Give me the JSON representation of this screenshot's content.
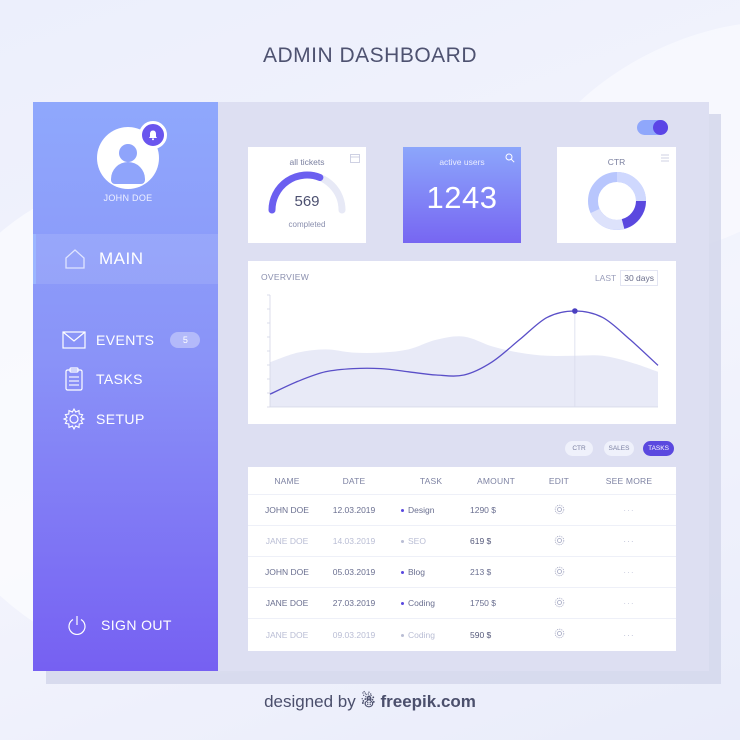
{
  "page_title": "ADMIN DASHBOARD",
  "sidebar": {
    "user_name": "JOHN DOE",
    "main_label": "MAIN",
    "items": [
      {
        "label": "EVENTS",
        "badge": "5",
        "icon": "mail-icon"
      },
      {
        "label": "TASKS",
        "icon": "clipboard-icon"
      },
      {
        "label": "SETUP",
        "icon": "gear-icon"
      }
    ],
    "signout_label": "SIGN OUT"
  },
  "cards": {
    "tickets": {
      "title": "all tickets",
      "value": "569",
      "sub": "completed",
      "progress": 0.62
    },
    "users": {
      "title": "active users",
      "value": "1243"
    },
    "ctr": {
      "title": "CTR"
    }
  },
  "overview": {
    "title": "OVERVIEW",
    "range_prefix": "LAST",
    "range_value": "30 days"
  },
  "chart_data": {
    "type": "area",
    "title": "OVERVIEW",
    "x": [
      0,
      1,
      2,
      3,
      4,
      5,
      6,
      7,
      8,
      9,
      10,
      11,
      12,
      13,
      14
    ],
    "series": [
      {
        "values": [
          4,
          8,
          11,
          12,
          12,
          11,
          10,
          10,
          14,
          21,
          28,
          30,
          28,
          21,
          13
        ]
      },
      {
        "values": [
          14,
          17,
          18,
          17,
          17,
          18,
          21,
          22,
          19,
          17,
          16,
          16,
          16,
          14,
          11
        ]
      }
    ],
    "ylim": [
      0,
      35
    ],
    "grid": false
  },
  "filters": [
    "CTR",
    "SALES",
    "TASKS"
  ],
  "table": {
    "headers": [
      "NAME",
      "DATE",
      "TASK",
      "AMOUNT",
      "EDIT",
      "SEE MORE"
    ],
    "rows": [
      {
        "name": "JOHN DOE",
        "date": "12.03.2019",
        "task": "Design",
        "amount": "1290 $",
        "more": "···"
      },
      {
        "name": "JANE DOE",
        "date": "14.03.2019",
        "task": "SEO",
        "amount": "619 $",
        "more": "···"
      },
      {
        "name": "JOHN DOE",
        "date": "05.03.2019",
        "task": "Blog",
        "amount": "213 $",
        "more": "···"
      },
      {
        "name": "JANE DOE",
        "date": "27.03.2019",
        "task": "Coding",
        "amount": "1750 $",
        "more": "···"
      },
      {
        "name": "JANE DOE",
        "date": "09.03.2019",
        "task": "Coding",
        "amount": "590 $",
        "more": "···"
      }
    ]
  },
  "credit": {
    "prefix": "designed by",
    "brand": "freepik.com"
  },
  "colors": {
    "accent": "#5a48df",
    "sidebar_top": "#8fa8fc",
    "sidebar_bottom": "#7660f2",
    "area": "#e8eaf7"
  }
}
